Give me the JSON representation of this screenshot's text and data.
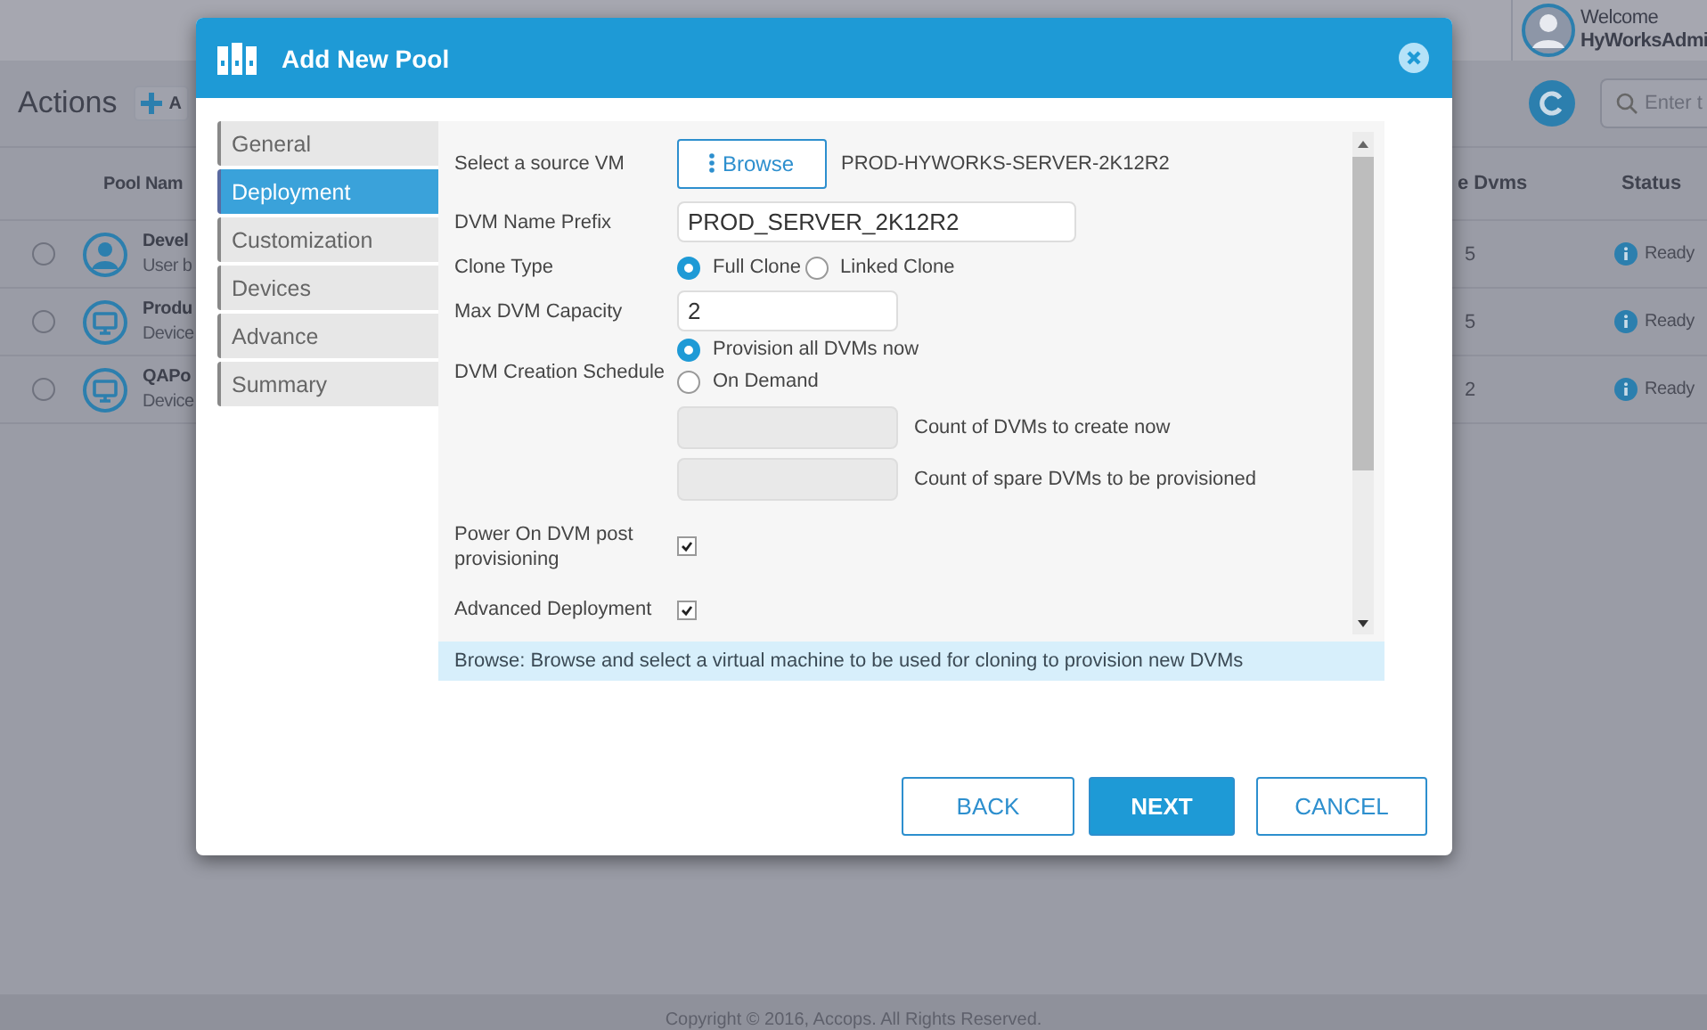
{
  "page": {
    "actions_title": "Actions",
    "add_button": "A",
    "welcome": "Welcome",
    "user": "HyWorksAdmi",
    "search": {
      "placeholder": "Enter t"
    },
    "table": {
      "columns": [
        "Pool Nam",
        "e Dvms",
        "Status"
      ],
      "rows": [
        {
          "kind": "user",
          "name": "Devel",
          "subtitle": "User b",
          "count": "5",
          "status": "Ready",
          "selected": false
        },
        {
          "kind": "device",
          "name": "Produ",
          "subtitle": "Device",
          "count": "5",
          "status": "Ready",
          "selected": false
        },
        {
          "kind": "device",
          "name": "QAPo",
          "subtitle": "Device",
          "count": "2",
          "status": "Ready",
          "selected": false
        }
      ]
    },
    "footer": "Copyright © 2016, Accops. All Rights Reserved."
  },
  "dialog": {
    "title": "Add New Pool",
    "tabs": [
      {
        "label": "General",
        "selected": false
      },
      {
        "label": "Deployment",
        "selected": true
      },
      {
        "label": "Customization",
        "selected": false
      },
      {
        "label": "Devices",
        "selected": false
      },
      {
        "label": "Advance",
        "selected": false
      },
      {
        "label": "Summary",
        "selected": false
      }
    ],
    "rows": [
      {
        "kind": "browse",
        "label": "Select a source VM",
        "button": "Browse",
        "value": "PROD-HYWORKS-SERVER-2K12R2"
      },
      {
        "kind": "text",
        "label": "DVM Name Prefix",
        "value": "PROD_SERVER_2K12R2"
      },
      {
        "kind": "radio",
        "label": "Clone Type",
        "options": [
          {
            "label": "Full Clone",
            "selected": true
          },
          {
            "label": "Linked Clone",
            "selected": false
          }
        ]
      },
      {
        "kind": "short",
        "label": "Max DVM Capacity",
        "value": "2"
      },
      {
        "kind": "schedule",
        "label": "DVM Creation Schedule",
        "options": [
          {
            "label": "Provision all DVMs now",
            "selected": true
          },
          {
            "label": "On Demand",
            "selected": false
          }
        ],
        "counts": [
          {
            "label": "Count of DVMs to create now",
            "disabled": true
          },
          {
            "label": "Count of spare DVMs to be provisioned",
            "disabled": true
          }
        ]
      },
      {
        "kind": "checkbox",
        "label": "Power On DVM post provisioning",
        "checked": true
      },
      {
        "kind": "checkbox",
        "label": "Advanced Deployment",
        "checked": true
      }
    ],
    "hint": "Browse: Browse and select a virtual machine to be used for cloning to provision new DVMs",
    "buttons": [
      {
        "label": "BACK",
        "primary": false
      },
      {
        "label": "NEXT",
        "primary": true
      },
      {
        "label": "CANCEL",
        "primary": false
      }
    ]
  }
}
